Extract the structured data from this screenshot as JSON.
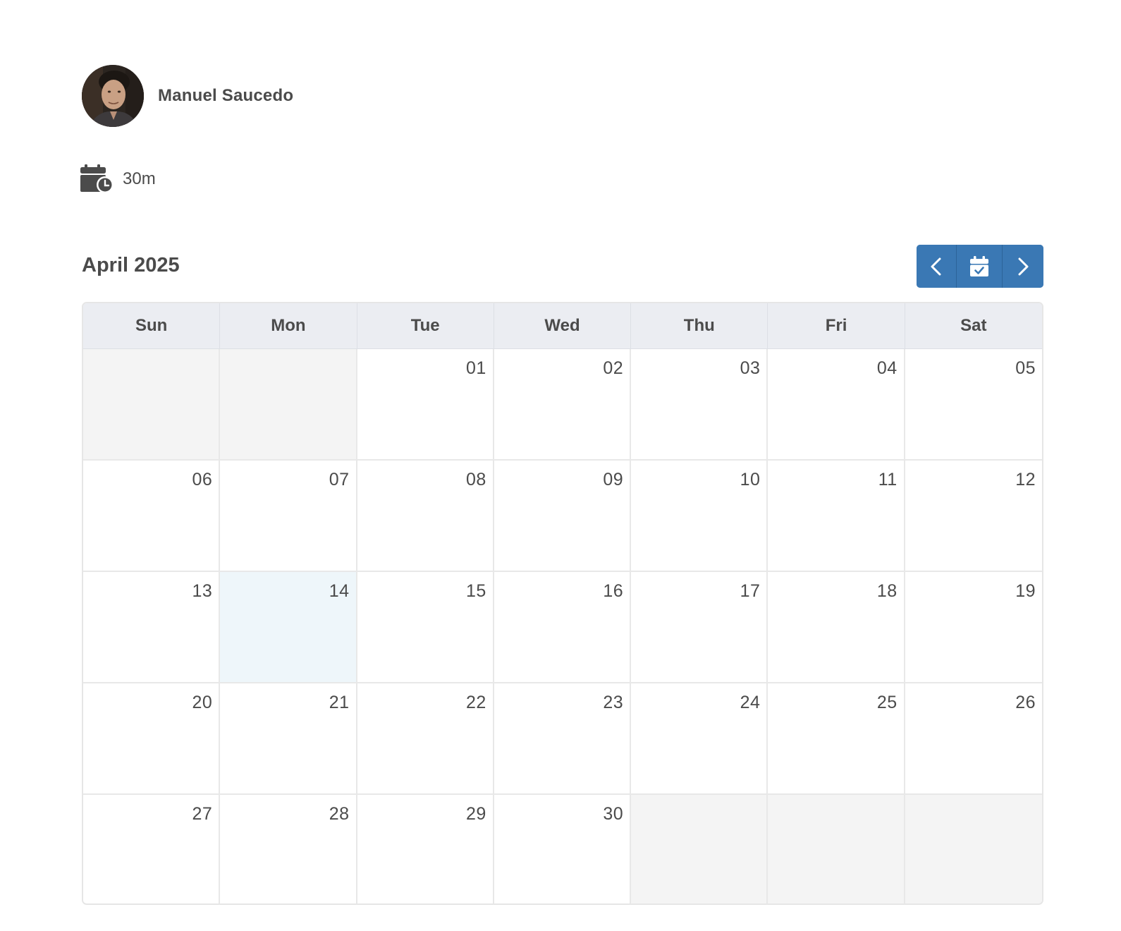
{
  "host": {
    "name": "Manuel Saucedo"
  },
  "event": {
    "duration": "30m",
    "icon": "calendar-clock-icon"
  },
  "calendar": {
    "month_title": "April 2025",
    "weekdays": [
      "Sun",
      "Mon",
      "Tue",
      "Wed",
      "Thu",
      "Fri",
      "Sat"
    ],
    "weeks": [
      [
        "",
        "",
        "01",
        "02",
        "03",
        "04",
        "05"
      ],
      [
        "06",
        "07",
        "08",
        "09",
        "10",
        "11",
        "12"
      ],
      [
        "13",
        "14",
        "15",
        "16",
        "17",
        "18",
        "19"
      ],
      [
        "20",
        "21",
        "22",
        "23",
        "24",
        "25",
        "26"
      ],
      [
        "27",
        "28",
        "29",
        "30",
        "",
        "",
        ""
      ]
    ],
    "highlighted_day": "14"
  },
  "nav": {
    "prev_icon": "chevron-left-icon",
    "today_icon": "calendar-check-icon",
    "next_icon": "chevron-right-icon"
  },
  "colors": {
    "accent": "#3a78b4",
    "today_bg": "#eef6fa",
    "empty_bg": "#f4f4f4",
    "header_bg": "#ebedf2"
  }
}
